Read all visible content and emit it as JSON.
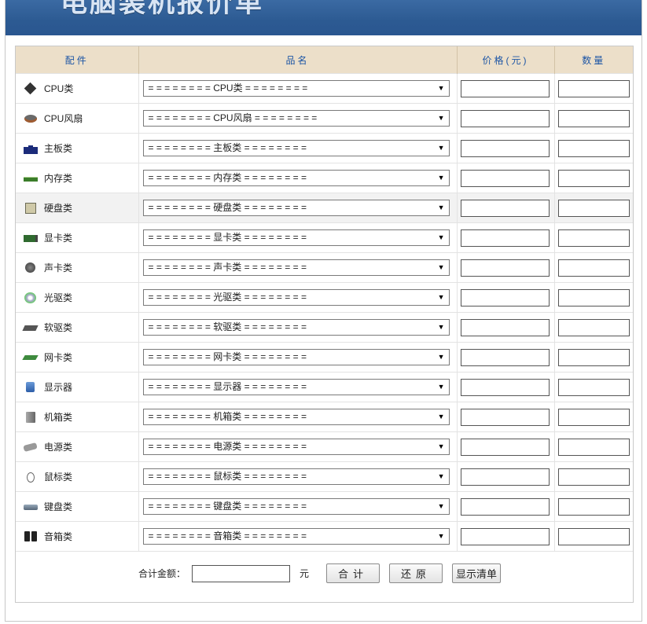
{
  "banner": {
    "title": "电脑装机报价单"
  },
  "headers": {
    "part": "配件",
    "name": "品名",
    "price": "价格(元)",
    "qty": "数量"
  },
  "rows": [
    {
      "label": "CPU类",
      "icon": "cpu-icon",
      "select": "= = = = = = = = CPU类 = = = = = = = ="
    },
    {
      "label": "CPU风扇",
      "icon": "cpu-fan-icon",
      "select": "= = = = = = = = CPU风扇 = = = = = = = ="
    },
    {
      "label": "主板类",
      "icon": "motherboard-icon",
      "select": "= = = = = = = = 主板类 = = = = = = = ="
    },
    {
      "label": "内存类",
      "icon": "memory-icon",
      "select": "= = = = = = = = 内存类 = = = = = = = ="
    },
    {
      "label": "硬盘类",
      "icon": "hard-disk-icon",
      "select": "= = = = = = = = 硬盘类 = = = = = = = ="
    },
    {
      "label": "显卡类",
      "icon": "graphics-card-icon",
      "select": "= = = = = = = = 显卡类 = = = = = = = ="
    },
    {
      "label": "声卡类",
      "icon": "sound-card-icon",
      "select": "= = = = = = = = 声卡类 = = = = = = = ="
    },
    {
      "label": "光驱类",
      "icon": "optical-drive-icon",
      "select": "= = = = = = = = 光驱类 = = = = = = = ="
    },
    {
      "label": "软驱类",
      "icon": "floppy-drive-icon",
      "select": "= = = = = = = = 软驱类 = = = = = = = ="
    },
    {
      "label": "网卡类",
      "icon": "network-card-icon",
      "select": "= = = = = = = = 网卡类 = = = = = = = ="
    },
    {
      "label": "显示器",
      "icon": "monitor-icon",
      "select": "= = = = = = = = 显示器 = = = = = = = ="
    },
    {
      "label": "机箱类",
      "icon": "case-icon",
      "select": "= = = = = = = = 机箱类 = = = = = = = ="
    },
    {
      "label": "电源类",
      "icon": "power-supply-icon",
      "select": "= = = = = = = = 电源类 = = = = = = = ="
    },
    {
      "label": "鼠标类",
      "icon": "mouse-icon",
      "select": "= = = = = = = = 鼠标类 = = = = = = = ="
    },
    {
      "label": "键盘类",
      "icon": "keyboard-icon",
      "select": "= = = = = = = = 键盘类 = = = = = = = ="
    },
    {
      "label": "音箱类",
      "icon": "speaker-icon",
      "select": "= = = = = = = = 音箱类 = = = = = = = ="
    }
  ],
  "footer": {
    "total_label": "合计金额：",
    "unit": "元",
    "sum_button": "合计",
    "reset_button": "还原",
    "list_button": "显示清单"
  },
  "colors": {
    "banner": "#2c5a92",
    "header_bg": "#ecdfc9",
    "header_text": "#1c55a5"
  }
}
